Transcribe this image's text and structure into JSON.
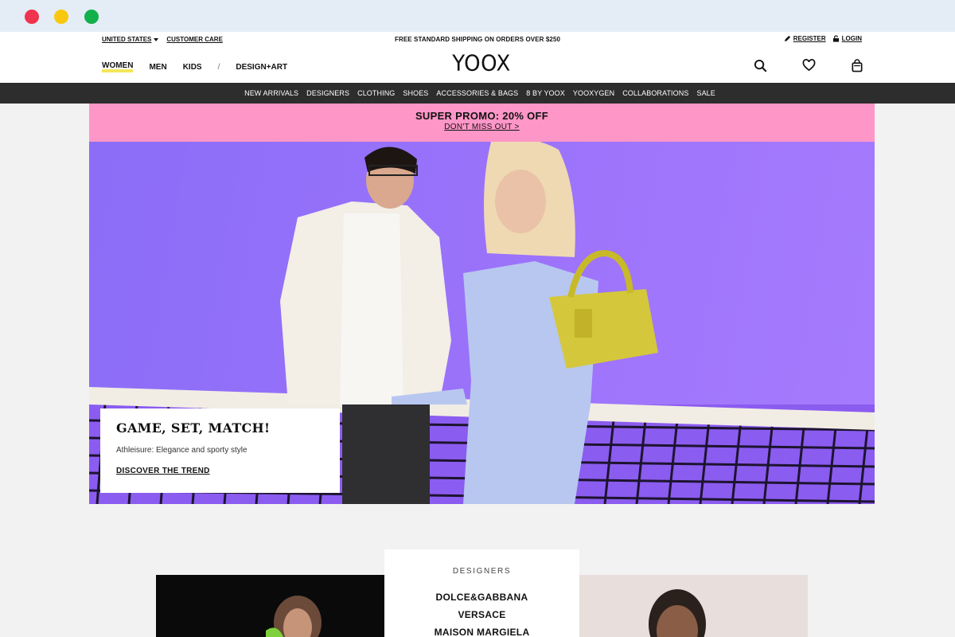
{
  "window": {
    "controls": [
      "close",
      "minimize",
      "maximize"
    ]
  },
  "header": {
    "country": "UNITED STATES",
    "customer_care": "CUSTOMER CARE",
    "shipping_notice": "FREE STANDARD SHIPPING ON ORDERS OVER $250",
    "register": "REGISTER",
    "login": "LOGIN",
    "logo": "YOOX",
    "gender_tabs": [
      "WOMEN",
      "MEN",
      "KIDS"
    ],
    "gender_separator": "/",
    "design_art": "DESIGN+ART",
    "active_tab": "WOMEN",
    "icons": [
      "search-icon",
      "heart-icon",
      "bag-icon"
    ]
  },
  "nav": {
    "items": [
      "NEW ARRIVALS",
      "DESIGNERS",
      "CLOTHING",
      "SHOES",
      "ACCESSORIES & BAGS",
      "8 BY YOOX",
      "YOOXYGEN",
      "COLLABORATIONS",
      "SALE"
    ]
  },
  "promo": {
    "title": "SUPER PROMO: 20% OFF",
    "cta": "DON'T MISS OUT >",
    "color": "#ff96c8"
  },
  "hero": {
    "heading": "GAME, SET, MATCH!",
    "subtitle": "Athleisure: Elegance and sporty style",
    "cta": "DISCOVER THE TREND",
    "background": "#9c73fb"
  },
  "designers": {
    "title": "DESIGNERS",
    "items": [
      "DOLCE&GABBANA",
      "VERSACE",
      "MAISON MARGIELA"
    ]
  },
  "colors": {
    "navbar": "#2d2d2d",
    "active_underline": "#f4e65a"
  }
}
